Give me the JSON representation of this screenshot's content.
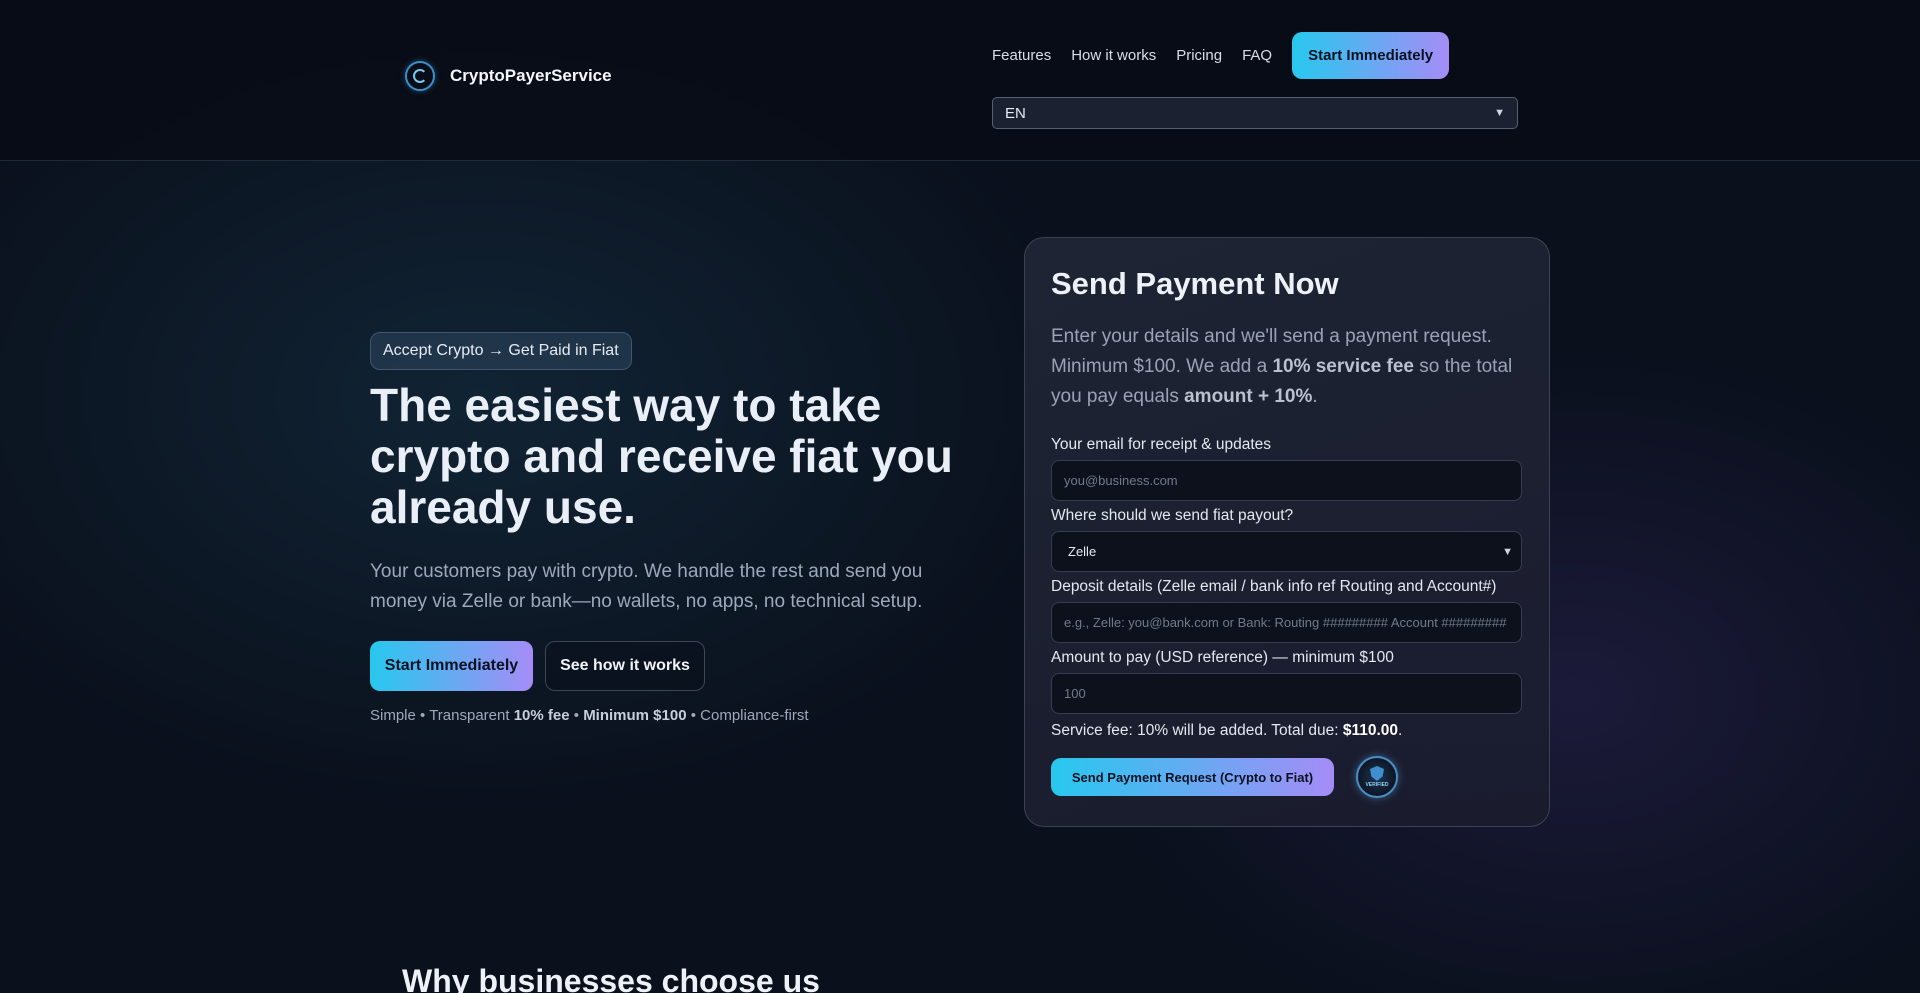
{
  "brand": {
    "name": "CryptoPayerService",
    "icon": "logo-c-icon"
  },
  "nav": {
    "links": [
      "Features",
      "How it works",
      "Pricing",
      "FAQ"
    ],
    "cta_label": "Start Immediately",
    "language": "EN"
  },
  "hero": {
    "pill": "Accept Crypto → Get Paid in Fiat",
    "title": "The easiest way to take crypto and receive fiat you already use.",
    "description": "Your customers pay with crypto. We handle the rest and send you money via Zelle or bank—no wallets, no apps, no technical setup.",
    "primary_button": "Start Immediately",
    "secondary_button": "See how it works",
    "note": {
      "simple": "Simple",
      "sep": "•",
      "transparent": "Transparent",
      "fee": "10% fee",
      "minimum": "Minimum $100",
      "compliance": "Compliance-first"
    }
  },
  "form": {
    "title": "Send Payment Now",
    "desc_part1": "Enter your details and we'll send a payment request. Minimum $100. We add a",
    "desc_fee": "10% service fee",
    "desc_part2": "so the total you pay equals",
    "desc_total": "amount + 10%",
    "desc_end": ".",
    "email_label": "Your email for receipt & updates",
    "email_placeholder": "you@business.com",
    "payout_label": "Where should we send fiat payout?",
    "payout_value": "Zelle",
    "deposit_label": "Deposit details (Zelle email / bank info ref Routing and Account#)",
    "deposit_placeholder": "e.g., Zelle: you@bank.com or Bank: Routing ######### Account #########",
    "amount_label": "Amount to pay (USD reference) — minimum $100",
    "amount_placeholder": "100",
    "fee_text": "Service fee: 10% will be added. Total due:",
    "fee_total": "$110.00",
    "fee_end": ".",
    "submit_label": "Send Payment Request (Crypto to Fiat)",
    "badge_text": "VERIFIED",
    "badge_icon": "verified-shield-icon"
  },
  "section": {
    "why_title": "Why businesses choose us"
  },
  "colors": {
    "accent_start": "#27c8ee",
    "accent_end": "#a58cf6",
    "background": "#0a101c"
  }
}
